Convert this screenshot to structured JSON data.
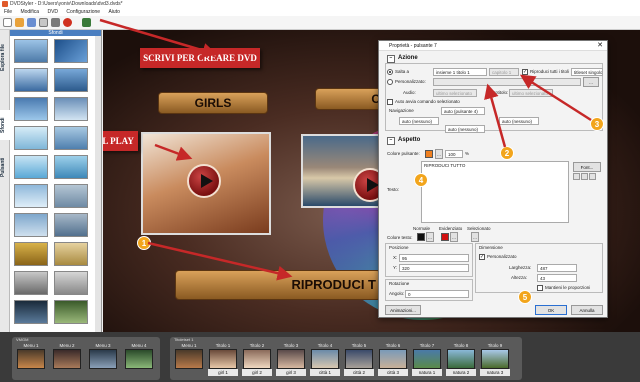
{
  "window": {
    "title": "DVDStyler - D:\\Users\\yoniv\\Downloads\\dvd3.dvds*"
  },
  "menu": [
    "File",
    "Modifica",
    "DVD",
    "Configurazione",
    "Aiuto"
  ],
  "side_tabs": [
    "Esplora file",
    "Sfondi",
    "Pulsanti"
  ],
  "backgrounds_header": "Sfondi",
  "canvas": {
    "button_girls": "GIRLS",
    "button_citta": "CITT",
    "button_riproduci": "RIPRODUCI T",
    "callout_create": "SCRIVI PER CREARE DVD",
    "callout_play": "PULSANTI DEL PLAY"
  },
  "badges": [
    "1",
    "2",
    "3",
    "4",
    "5"
  ],
  "colors": {
    "callout_red": "#c62828",
    "badge_orange": "#f2a51c",
    "accent_blue": "#2a6fd1"
  },
  "dialog": {
    "title": "Proprietà - pulsante 7",
    "close": "✕",
    "section_action": "Azione",
    "goto_label": "Salta a",
    "goto_value": "insieme 1 titolo 1",
    "chapter_value": "capitolo 1",
    "play_all_label": "Riproduci tutti i titoli",
    "play_all_value": "titleset singolo",
    "custom_label": "Personalizzato:",
    "audio_label": "Audio:",
    "audio_value": "ultimo selezionato",
    "subtitle_label": "Sottotitolo:",
    "subtitle_value": "ultimo selezionato",
    "auto_exec_label": "Auto avvia comando selezionato",
    "nav_label": "Navigazione",
    "nav_values": [
      "auto (nessuno)",
      "auto (pulsante 4)",
      "auto (nessuno)",
      "auto (nessuno)"
    ],
    "section_appearance": "Aspetto",
    "button_color_label": "Colore pulsante:",
    "opacity_value": "100",
    "percent": "%",
    "text_label": "Testo:",
    "text_value": "RIPRODUCI TUTTO",
    "font_button": "Font...",
    "col_normal": "Normale",
    "col_highlight": "Evidenziato",
    "col_selected": "Selezionato",
    "text_color_label": "Colore testo:",
    "position_label": "Posizione",
    "x_label": "X:",
    "x_value": "95",
    "y_label": "Y:",
    "y_value": "320",
    "dimension_label": "Dimensione",
    "custom_size_label": "Personalizzato",
    "width_label": "Larghezza:",
    "width_value": "487",
    "height_label": "Altezza:",
    "height_value": "43",
    "keep_ratio_label": "Mantieni le proporzioni",
    "rotation_label": "Rotazione",
    "angle_label": "Angolo:",
    "angle_value": "0",
    "animations_button": "Animazioni...",
    "ok_button": "OK",
    "cancel_button": "Annulla",
    "ellipsis": "..."
  },
  "bottom": {
    "vmgm_label": "VMGM",
    "titleset_label": "Titoletset 1",
    "menus": [
      {
        "label": "Menu 1",
        "name": ""
      },
      {
        "label": "Menu 2",
        "name": ""
      },
      {
        "label": "Menu 3",
        "name": ""
      },
      {
        "label": "Menu 4",
        "name": ""
      }
    ],
    "titles": [
      {
        "label": "Menu 1",
        "name": ""
      },
      {
        "label": "Titolo 1",
        "name": "girl 1"
      },
      {
        "label": "Titolo 2",
        "name": "girl 2"
      },
      {
        "label": "Titolo 3",
        "name": "girl 3"
      },
      {
        "label": "Titolo 4",
        "name": "città 1"
      },
      {
        "label": "Titolo 5",
        "name": "città 2"
      },
      {
        "label": "Titolo 6",
        "name": "città 3"
      },
      {
        "label": "Titolo 7",
        "name": "natura 1"
      },
      {
        "label": "Titolo 8",
        "name": "natura 2"
      },
      {
        "label": "Titolo 9",
        "name": "natura 3"
      }
    ]
  }
}
